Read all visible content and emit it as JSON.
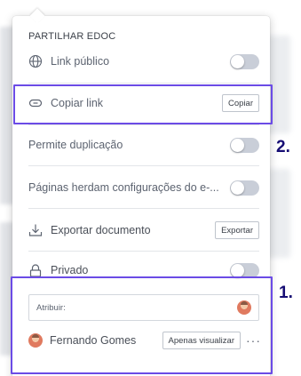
{
  "panel": {
    "title": "PARTILHAR EDOC",
    "public_link": {
      "label": "Link público",
      "on": false
    },
    "copy_link": {
      "label": "Copiar link",
      "button": "Copiar"
    },
    "allow_duplication": {
      "label": "Permite duplicação",
      "on": false
    },
    "pages_inherit": {
      "label": "Páginas herdam configurações do e-...",
      "on": false
    },
    "export": {
      "label": "Exportar documento",
      "button": "Exportar"
    },
    "private": {
      "label": "Privado",
      "on": false
    },
    "assign": {
      "placeholder": "Atribuir:"
    },
    "user": {
      "name": "Fernando Gomes",
      "permission": "Apenas visualizar",
      "more": "···"
    }
  },
  "annotations": {
    "marker_1": "1.",
    "marker_2": "2.",
    "highlight_color": "#6b4be6",
    "number_color": "#160d74"
  },
  "icons": {
    "public_link": "globe-icon",
    "copy_link": "link-icon",
    "export": "download-icon",
    "private": "lock-icon"
  }
}
